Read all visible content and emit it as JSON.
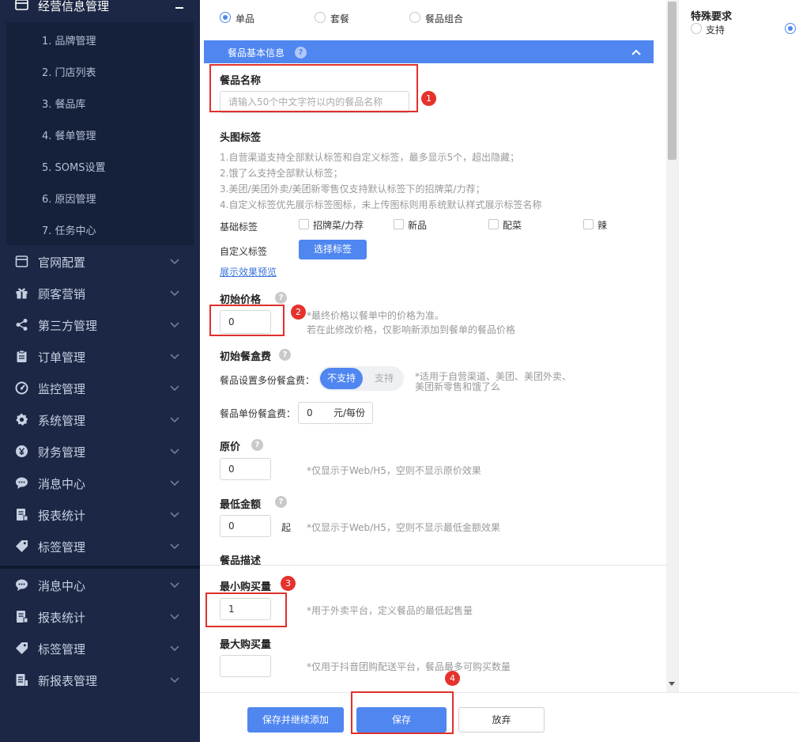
{
  "sidebar": {
    "section_title": "经营信息管理",
    "sub_items": [
      "1. 品牌管理",
      "2. 门店列表",
      "3. 餐品库",
      "4. 餐单管理",
      "5. SOMS设置",
      "6. 原因管理",
      "7. 任务中心"
    ],
    "menu_items": [
      {
        "label": "官网配置",
        "icon": "window-icon"
      },
      {
        "label": "顾客营销",
        "icon": "gift-icon"
      },
      {
        "label": "第三方管理",
        "icon": "share-icon"
      },
      {
        "label": "订单管理",
        "icon": "clipboard-icon"
      },
      {
        "label": "监控管理",
        "icon": "gauge-icon"
      },
      {
        "label": "系统管理",
        "icon": "gear-icon"
      },
      {
        "label": "财务管理",
        "icon": "yen-icon"
      },
      {
        "label": "消息中心",
        "icon": "chat-icon"
      },
      {
        "label": "报表统计",
        "icon": "report-icon"
      },
      {
        "label": "标签管理",
        "icon": "tag-icon"
      }
    ],
    "menu_items_lower": [
      {
        "label": "消息中心",
        "icon": "chat-icon"
      },
      {
        "label": "报表统计",
        "icon": "report-icon"
      },
      {
        "label": "标签管理",
        "icon": "tag-icon"
      },
      {
        "label": "新报表管理",
        "icon": "new-report-icon"
      }
    ]
  },
  "form": {
    "type_options": {
      "opt1": "单品",
      "opt2": "套餐",
      "opt3": "餐品组合"
    },
    "section_title": "餐品基本信息",
    "name": {
      "label": "餐品名称",
      "placeholder": "请输入50个中文字符以内的餐品名称"
    },
    "tags": {
      "label": "头图标签",
      "notes": [
        "1.自营渠道支持全部默认标签和自定义标签，最多显示5个，超出隐藏；",
        "2.饿了么支持全部默认标签；",
        "3.美团/美团外卖/美团新零售仅支持默认标签下的招牌菜/力荐；",
        "4.自定义标签优先展示标签图标，未上传图标则用系统默认样式展示标签名称"
      ],
      "basic_label": "基础标签",
      "basic_options": [
        "招牌菜/力荐",
        "新品",
        "配菜",
        "辣"
      ],
      "custom_label": "自定义标签",
      "select_button": "选择标签",
      "preview_link": "展示效果预览"
    },
    "initial_price": {
      "label": "初始价格",
      "value": "0",
      "hint1": "*最终价格以餐单中的价格为准。",
      "hint2": "若在此修改价格，仅影响新添加到餐单的餐品价格"
    },
    "box_fee": {
      "label": "初始餐盒费",
      "multi_label": "餐品设置多份餐盒费：",
      "toggle_on": "不支持",
      "toggle_off": "支持",
      "multi_hint1": "*适用于自营渠道、美团、美团外卖、",
      "multi_hint2": "美团新零售和饿了么",
      "single_label": "餐品单份餐盒费：",
      "single_value": "0",
      "single_unit": "元/每份"
    },
    "original_price": {
      "label": "原价",
      "value": "0",
      "hint": "*仅显示于Web/H5，空则不显示原价效果"
    },
    "min_amount": {
      "label": "最低金额",
      "value": "0",
      "unit": "起",
      "hint": "*仅显示于Web/H5，空则不显示最低金额效果"
    },
    "description": {
      "label": "餐品描述"
    },
    "min_purchase": {
      "label": "最小购买量",
      "value": "1",
      "hint": "*用于外卖平台，定义餐品的最低起售量"
    },
    "max_purchase": {
      "label": "最大购买量",
      "value": "",
      "hint": "*仅用于抖音团购配送平台，餐品最多可购买数量"
    }
  },
  "right_panel": {
    "title": "特殊要求",
    "option_support": "支持"
  },
  "annotations": {
    "n1": "1",
    "n2": "2",
    "n3": "3",
    "n4": "4"
  },
  "buttons": {
    "save_continue": "保存并继续添加",
    "save": "保存",
    "discard": "放弃"
  },
  "colors": {
    "accent": "#4f86f0",
    "sidebar": "#1b2744",
    "annotation": "#e5322d"
  }
}
